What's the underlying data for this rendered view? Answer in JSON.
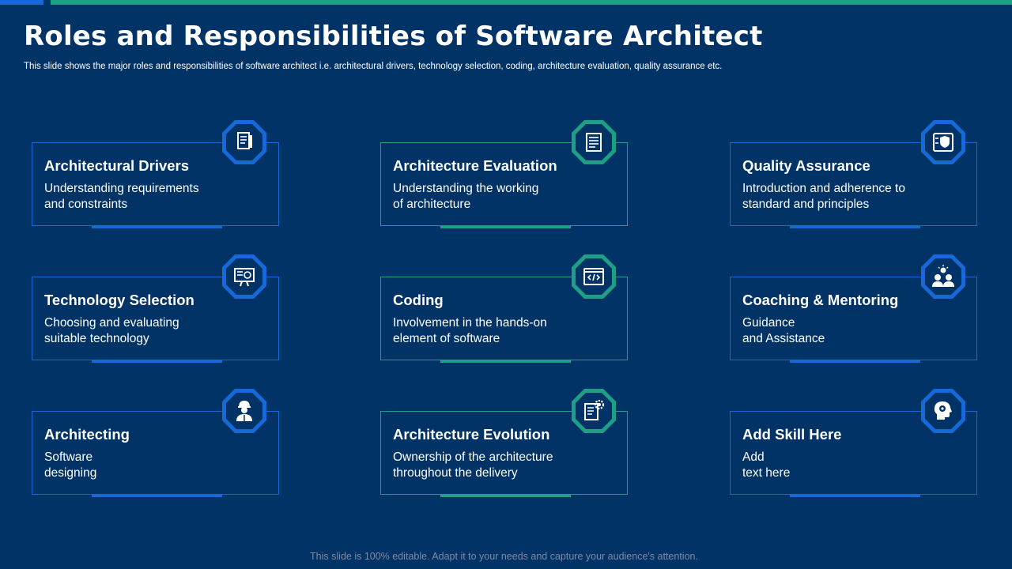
{
  "title": "Roles and Responsibilities of Software Architect",
  "subtitle": "This slide shows the major roles and responsibilities of software architect i.e. architectural drivers, technology selection, coding, architecture evaluation, quality assurance etc.",
  "footer": "This slide is 100% editable. Adapt it to your needs and capture your audience's attention.",
  "colors": {
    "background": "#013366",
    "blue_accent": "#1669d6",
    "green_accent": "#1f9f86"
  },
  "cards": [
    {
      "title": "Architectural Drivers",
      "desc": "Understanding requirements\nand constraints",
      "icon": "document-icon",
      "accent": "blue"
    },
    {
      "title": "Architecture Evaluation",
      "desc": "Understanding the working\nof architecture",
      "icon": "checklist-icon",
      "accent": "green"
    },
    {
      "title": "Quality Assurance",
      "desc": "Introduction  and adherence to\nstandard and principles",
      "icon": "shield-checklist-icon",
      "accent": "blue"
    },
    {
      "title": "Technology Selection",
      "desc": "Choosing and evaluating\nsuitable technology",
      "icon": "blueprint-icon",
      "accent": "blue"
    },
    {
      "title": "Coding",
      "desc": "Involvement  in the hands-on\nelement of software",
      "icon": "code-window-icon",
      "accent": "green"
    },
    {
      "title": "Coaching & Mentoring",
      "desc": "Guidance\nand Assistance",
      "icon": "mentoring-icon",
      "accent": "blue"
    },
    {
      "title": "Architecting",
      "desc": "Software\ndesigning",
      "icon": "engineer-icon",
      "accent": "blue"
    },
    {
      "title": "Architecture Evolution",
      "desc": "Ownership  of the architecture\nthroughout  the delivery",
      "icon": "gear-document-icon",
      "accent": "green"
    },
    {
      "title": "Add Skill Here",
      "desc": "Add\ntext here",
      "icon": "head-gear-icon",
      "accent": "blue"
    }
  ]
}
